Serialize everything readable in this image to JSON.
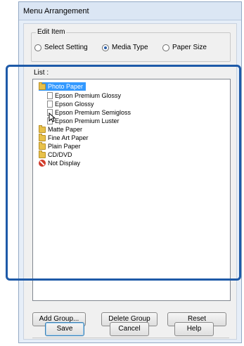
{
  "dialog": {
    "title": "Menu Arrangement"
  },
  "edit_item": {
    "label": "Edit Item",
    "options": [
      {
        "label": "Select Setting",
        "selected": false
      },
      {
        "label": "Media Type",
        "selected": true
      },
      {
        "label": "Paper Size",
        "selected": false
      }
    ]
  },
  "list": {
    "label": "List :",
    "items": [
      {
        "label": "Photo Paper",
        "icon": "folder-icon",
        "selected": true
      },
      {
        "label": "Epson Premium Glossy",
        "icon": "document-icon"
      },
      {
        "label": "Epson Glossy",
        "icon": "document-icon"
      },
      {
        "label": "Epson Premium Semigloss",
        "icon": "document-icon"
      },
      {
        "label": "Epson Premium Luster",
        "icon": "document-icon"
      },
      {
        "label": "Matte Paper",
        "icon": "folder-icon"
      },
      {
        "label": "Fine Art Paper",
        "icon": "folder-icon"
      },
      {
        "label": "Plain Paper",
        "icon": "folder-icon"
      },
      {
        "label": "CD/DVD",
        "icon": "folder-icon"
      },
      {
        "label": "Not Display",
        "icon": "no-entry-icon"
      }
    ]
  },
  "buttons": {
    "add_group": "Add Group...",
    "delete_group": "Delete Group",
    "reset": "Reset",
    "save": "Save",
    "cancel": "Cancel",
    "help": "Help"
  },
  "colors": {
    "selection": "#3399ff",
    "highlight_frame": "#1e5aa8"
  }
}
